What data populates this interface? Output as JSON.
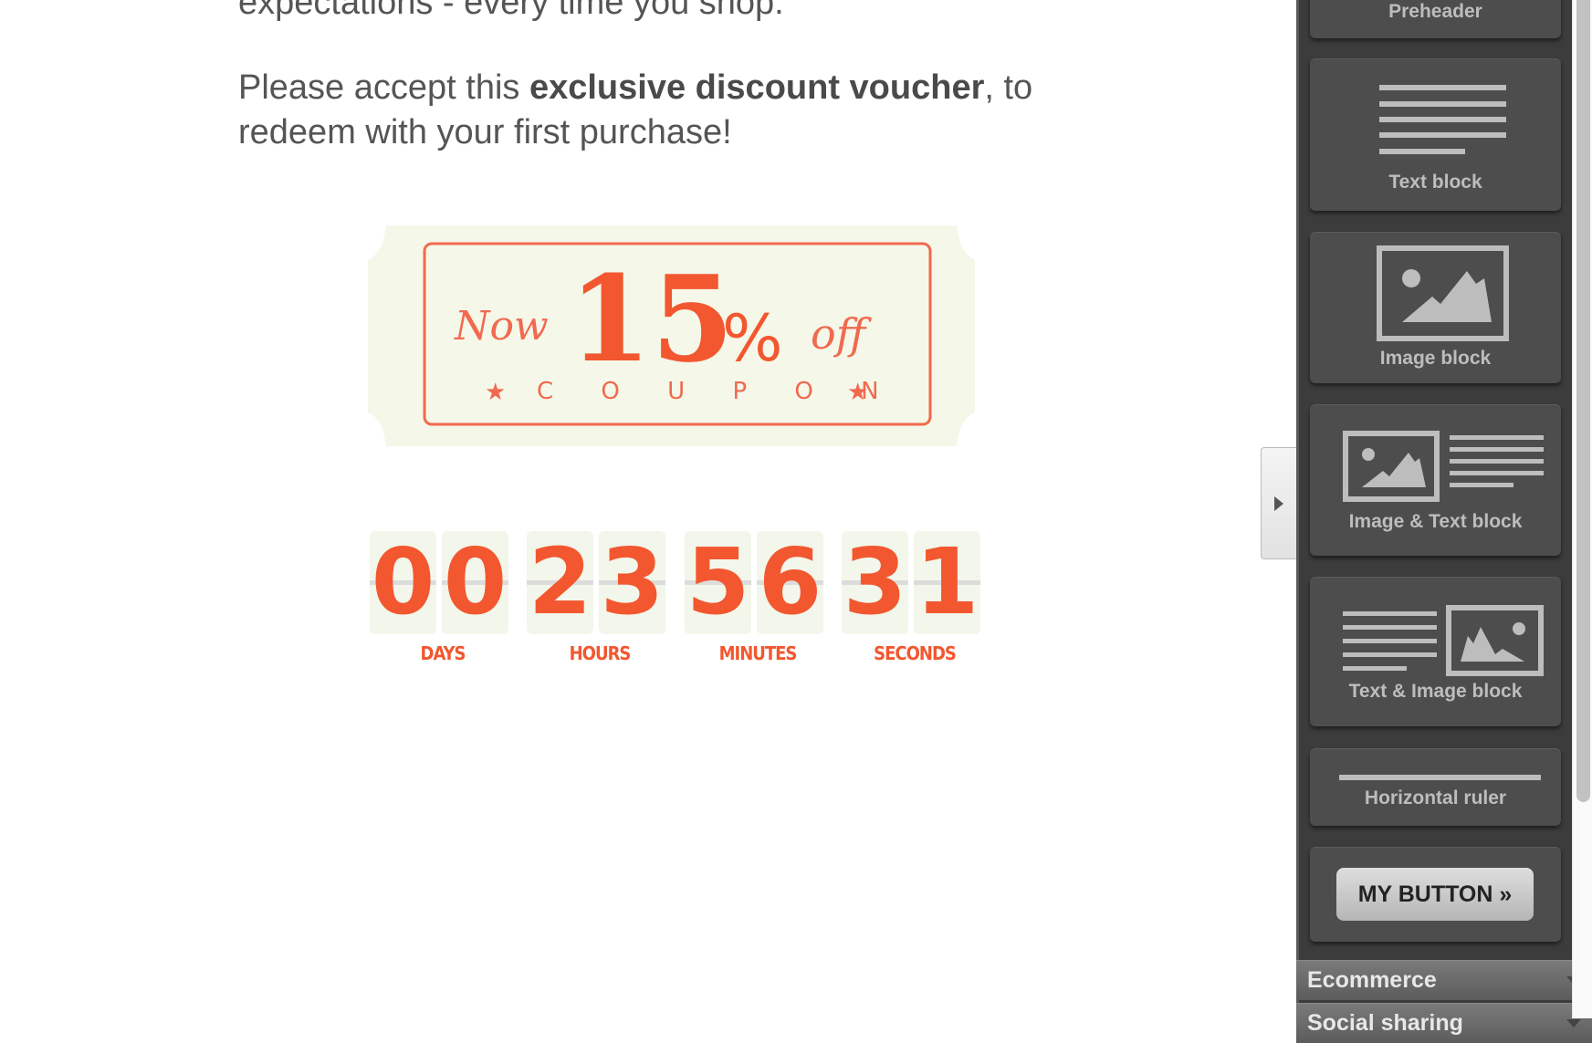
{
  "email": {
    "para1_tail": "expectations - every time you shop.",
    "para2": {
      "before": "Please accept this ",
      "bold": "exclusive discount voucher",
      "after": ", to",
      "line2": "redeem with your first purchase!"
    },
    "coupon": {
      "prefix": "Now",
      "amount": "15",
      "percent": "%",
      "suffix": "off",
      "word": "C O U P O N"
    },
    "countdown": {
      "digits": [
        "0",
        "0",
        "2",
        "3",
        "5",
        "6",
        "3",
        "1"
      ],
      "labels": [
        "DAYS",
        "HOURS",
        "MINUTES",
        "SECONDS"
      ],
      "color": "#f2572f"
    }
  },
  "sidebar": {
    "blocks": [
      "Preheader",
      "Text block",
      "Image block",
      "Image & Text block",
      "Text & Image block",
      "Horizontal ruler"
    ],
    "button_label": "MY BUTTON »",
    "sections": [
      "Ecommerce",
      "Social sharing"
    ]
  }
}
